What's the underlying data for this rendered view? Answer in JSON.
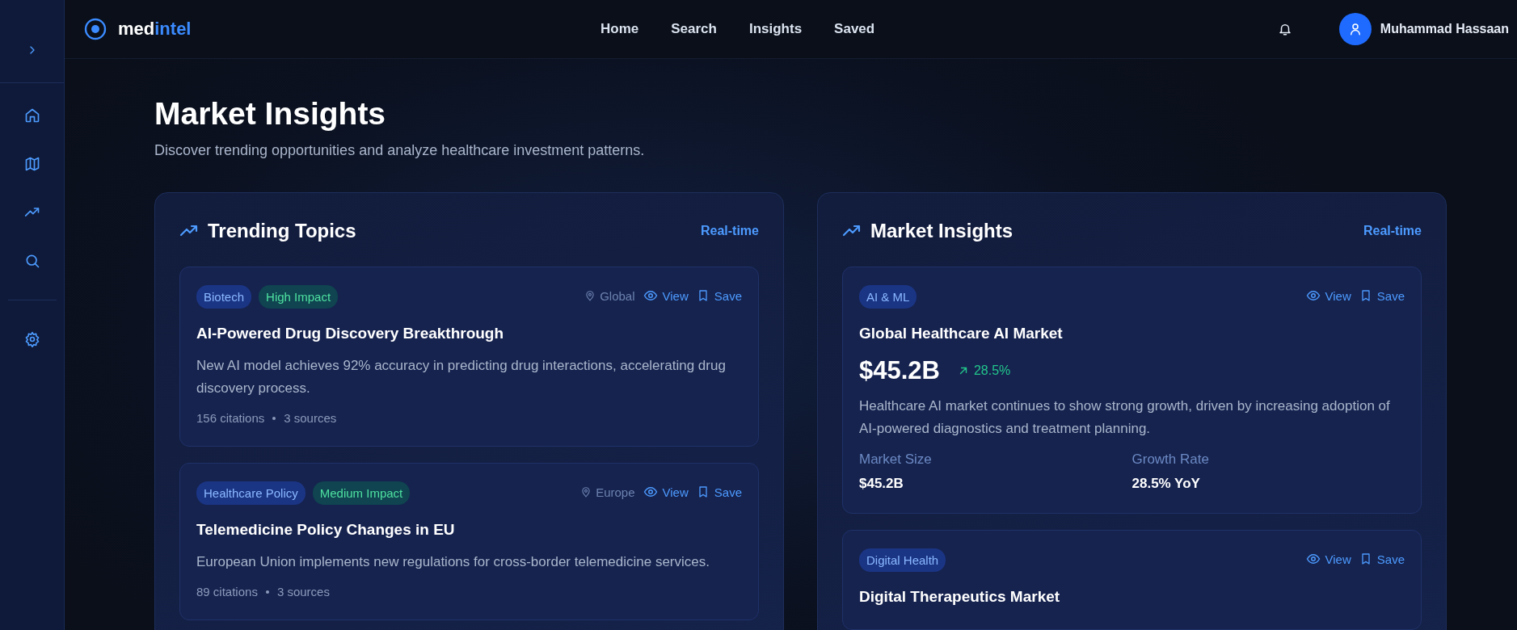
{
  "brand": {
    "prefix": "med",
    "suffix": "intel"
  },
  "nav": [
    {
      "label": "Home"
    },
    {
      "label": "Search"
    },
    {
      "label": "Insights"
    },
    {
      "label": "Saved"
    }
  ],
  "user": {
    "name": "Muhammad Hassaan"
  },
  "page": {
    "title": "Market Insights",
    "subtitle": "Discover trending opportunities and analyze healthcare investment patterns."
  },
  "trending": {
    "title": "Trending Topics",
    "badge": "Real-time",
    "items": [
      {
        "tags": [
          {
            "label": "Biotech",
            "kind": "category"
          },
          {
            "label": "High Impact",
            "kind": "impact"
          }
        ],
        "location": "Global",
        "view": "View",
        "save": "Save",
        "title": "AI-Powered Drug Discovery Breakthrough",
        "description": "New AI model achieves 92% accuracy in predicting drug interactions, accelerating drug discovery process.",
        "citations": "156 citations",
        "sources": "3 sources"
      },
      {
        "tags": [
          {
            "label": "Healthcare Policy",
            "kind": "category"
          },
          {
            "label": "Medium Impact",
            "kind": "impact"
          }
        ],
        "location": "Europe",
        "view": "View",
        "save": "Save",
        "title": "Telemedicine Policy Changes in EU",
        "description": "European Union implements new regulations for cross-border telemedicine services.",
        "citations": "89 citations",
        "sources": "3 sources"
      }
    ]
  },
  "market": {
    "title": "Market Insights",
    "badge": "Real-time",
    "items": [
      {
        "tag": "AI & ML",
        "view": "View",
        "save": "Save",
        "title": "Global Healthcare AI Market",
        "value": "$45.2B",
        "change": "28.5%",
        "description": "Healthcare AI market continues to show strong growth, driven by increasing adoption of AI-powered diagnostics and treatment planning.",
        "stats": [
          {
            "label": "Market Size",
            "value": "$45.2B"
          },
          {
            "label": "Growth Rate",
            "value": "28.5% YoY"
          }
        ]
      },
      {
        "tag": "Digital Health",
        "view": "View",
        "save": "Save",
        "title": "Digital Therapeutics Market"
      }
    ]
  }
}
